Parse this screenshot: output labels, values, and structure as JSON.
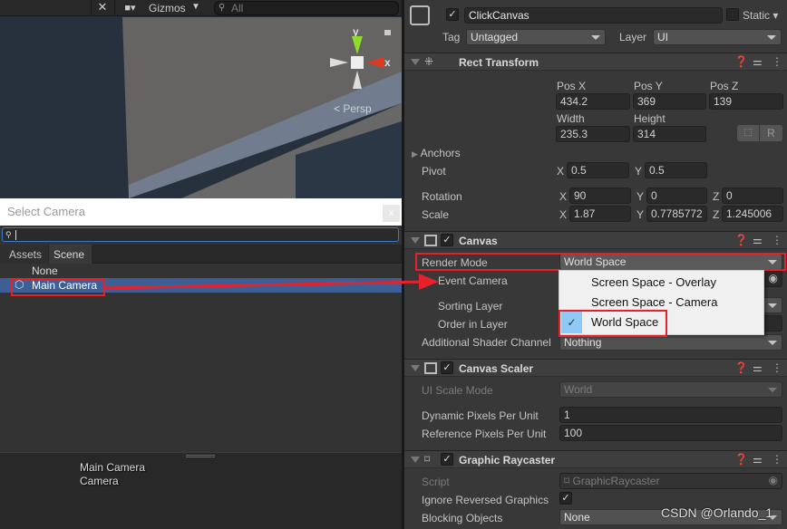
{
  "scene": {
    "toolbar": {
      "gizmos_label": "Gizmos",
      "search_placeholder": "All"
    },
    "gizmo": {
      "y_label": "y",
      "x_label": "x",
      "persp_label": "Persp"
    }
  },
  "picker": {
    "title": "Select Camera",
    "close_label": "x",
    "search_value": "",
    "tabs": [
      {
        "label": "Assets"
      },
      {
        "label": "Scene",
        "active": true
      }
    ],
    "items": [
      {
        "label": "None"
      },
      {
        "label": "Main Camera",
        "selected": true
      }
    ],
    "preview": {
      "name": "Main Camera",
      "type": "Camera"
    }
  },
  "inspector": {
    "object": {
      "name": "ClickCanvas",
      "active": true,
      "static_label": "Static",
      "static": false,
      "tag_label": "Tag",
      "tag": "Untagged",
      "layer_label": "Layer",
      "layer": "UI"
    },
    "rect_transform": {
      "title": "Rect Transform",
      "pos_x_label": "Pos X",
      "pos_y_label": "Pos Y",
      "pos_z_label": "Pos Z",
      "pos_x": "434.2",
      "pos_y": "369",
      "pos_z": "139",
      "width_label": "Width",
      "height_label": "Height",
      "width": "235.3",
      "height": "314",
      "r_label": "R",
      "anchors_label": "Anchors",
      "pivot_label": "Pivot",
      "pivot_x": "0.5",
      "pivot_y": "0.5",
      "rotation_label": "Rotation",
      "rot_x": "90",
      "rot_y": "0",
      "rot_z": "0",
      "scale_label": "Scale",
      "scale_x": "1.87",
      "scale_y": "0.7785772",
      "scale_z": "1.245006",
      "x": "X",
      "y": "Y",
      "z": "Z"
    },
    "canvas": {
      "title": "Canvas",
      "enabled": true,
      "render_mode_label": "Render Mode",
      "render_mode": "World Space",
      "event_camera_label": "Event Camera",
      "sorting_layer_label": "Sorting Layer",
      "order_label": "Order in Layer",
      "shader_label": "Additional Shader Channel",
      "shader_value": "Nothing",
      "options": [
        {
          "label": "Screen Space - Overlay"
        },
        {
          "label": "Screen Space - Camera"
        },
        {
          "label": "World Space",
          "checked": true
        }
      ]
    },
    "canvas_scaler": {
      "title": "Canvas Scaler",
      "enabled": true,
      "scale_mode_label": "UI Scale Mode",
      "scale_mode": "World",
      "dynamic_label": "Dynamic Pixels Per Unit",
      "dynamic": "1",
      "reference_label": "Reference Pixels Per Unit",
      "reference": "100"
    },
    "graphic_raycaster": {
      "title": "Graphic Raycaster",
      "enabled": true,
      "script_label": "Script",
      "script": "GraphicRaycaster",
      "ignore_label": "Ignore Reversed Graphics",
      "ignore": true,
      "blocking_label": "Blocking Objects",
      "blocking": "None"
    }
  },
  "watermark": "CSDN @Orlando_1",
  "colors": {
    "selection": "#3e5f96",
    "annotation": "#e8202a",
    "gizmo_y": "#8fdc2a",
    "gizmo_x": "#e03a1e"
  }
}
